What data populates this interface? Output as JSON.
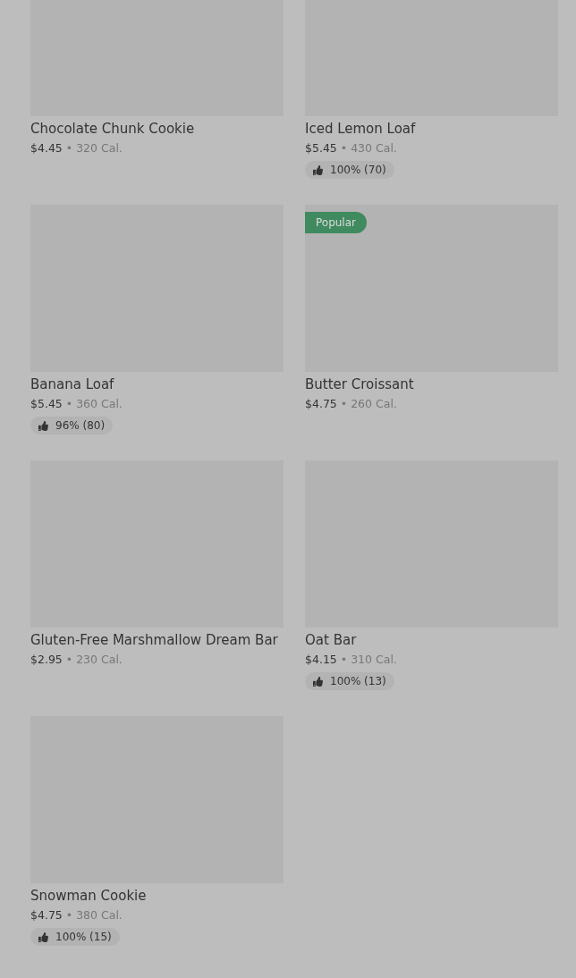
{
  "rows": [
    {
      "items": [
        {
          "name": "Chocolate Chunk Cookie",
          "price": "$4.45",
          "separator": "•",
          "calories": "320 Cal."
        },
        {
          "name": "Iced Lemon Loaf",
          "price": "$5.45",
          "separator": "•",
          "calories": "430 Cal.",
          "rating": "100% (70)"
        }
      ]
    },
    {
      "items": [
        {
          "name": "Banana Loaf",
          "price": "$5.45",
          "separator": "•",
          "calories": "360 Cal.",
          "rating": "96% (80)"
        },
        {
          "name": "Butter Croissant",
          "price": "$4.75",
          "separator": "•",
          "calories": "260 Cal.",
          "badge": "Popular"
        }
      ]
    },
    {
      "items": [
        {
          "name": "Gluten-Free Marshmallow Dream Bar",
          "price": "$2.95",
          "separator": "•",
          "calories": "230 Cal."
        },
        {
          "name": "Oat Bar",
          "price": "$4.15",
          "separator": "•",
          "calories": "310 Cal.",
          "rating": "100% (13)"
        }
      ]
    },
    {
      "items": [
        {
          "name": "Snowman Cookie",
          "price": "$4.75",
          "separator": "•",
          "calories": "380 Cal.",
          "rating": "100% (15)"
        }
      ]
    }
  ]
}
